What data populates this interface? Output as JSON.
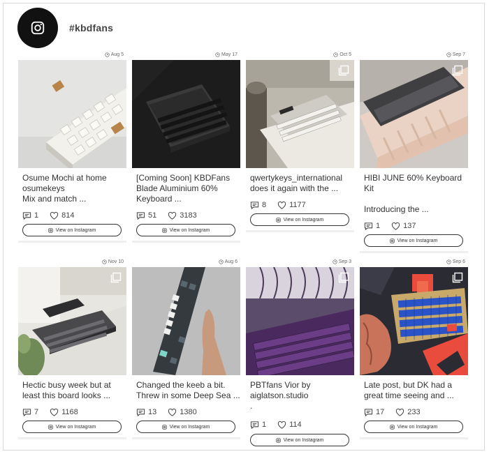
{
  "profile": {
    "handle": "#kbdfans",
    "icon": "instagram-icon"
  },
  "button_label": "View on Instagram",
  "posts": [
    {
      "date": "Aug 5",
      "caption": [
        "Osume Mochi at home",
        "osumekeys",
        "Mix and match ..."
      ],
      "comments": "1",
      "likes": "814"
    },
    {
      "date": "May 17",
      "caption": [
        "[Coming Soon] KBDFans",
        "Blade Aluminium 60%",
        "Keyboard ..."
      ],
      "comments": "51",
      "likes": "3183"
    },
    {
      "date": "Oct 5",
      "caption": [
        "qwertykeys_international",
        "does it again with the ..."
      ],
      "comments": "8",
      "likes": "1177"
    },
    {
      "date": "Sep 7",
      "caption": [
        "HIBI JUNE 60% Keyboard",
        "Kit",
        "",
        "Introducing the ..."
      ],
      "comments": "1",
      "likes": "137"
    },
    {
      "date": "Nov 10",
      "caption": [
        "Hectic busy week but at",
        "least this board looks ..."
      ],
      "comments": "7",
      "likes": "1168"
    },
    {
      "date": "Aug 6",
      "caption": [
        "Changed the keeb a bit.",
        "Threw in some Deep Sea ..."
      ],
      "comments": "13",
      "likes": "1380"
    },
    {
      "date": "Sep 3",
      "caption": [
        "PBTfans Vior by",
        "aiglatson.studio",
        "."
      ],
      "comments": "1",
      "likes": "114"
    },
    {
      "date": "Sep 6",
      "caption": [
        "Late post, but DK had a",
        "great time seeing and ..."
      ],
      "comments": "17",
      "likes": "233"
    }
  ],
  "colors": {
    "accent": "#111111",
    "border": "#333333"
  }
}
